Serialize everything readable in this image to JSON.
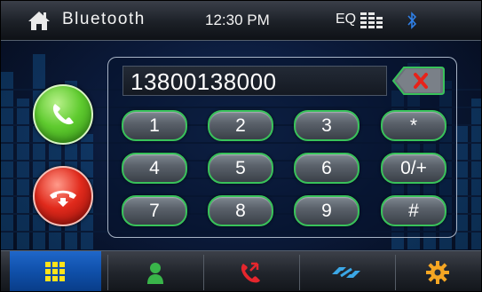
{
  "status_bar": {
    "title": "Bluetooth",
    "time": "12:30 PM",
    "eq_label": "EQ",
    "icons": [
      "home-icon",
      "equalizer-icon",
      "bluetooth-icon"
    ]
  },
  "dialer": {
    "number": "13800138000",
    "keys": [
      [
        "1",
        "2",
        "3",
        "*"
      ],
      [
        "4",
        "5",
        "6",
        "0/+"
      ],
      [
        "7",
        "8",
        "9",
        "#"
      ]
    ],
    "backspace_icon": "backspace-x-icon"
  },
  "call_controls": {
    "answer_icon": "phone-answer-icon",
    "hangup_icon": "phone-hangup-icon"
  },
  "bottom_tabs": [
    {
      "icon": "keypad-grid-icon",
      "active": true
    },
    {
      "icon": "contacts-person-icon",
      "active": false
    },
    {
      "icon": "call-log-phone-icon",
      "active": false
    },
    {
      "icon": "pair-link-icon",
      "active": false
    },
    {
      "icon": "settings-gear-icon",
      "active": false
    }
  ],
  "colors": {
    "accent_green": "#38c25a",
    "answer_green": "#5fcb2f",
    "hangup_red": "#e12a1c",
    "active_tab_blue": "#0f4fa8",
    "gear_orange": "#f5a623"
  }
}
